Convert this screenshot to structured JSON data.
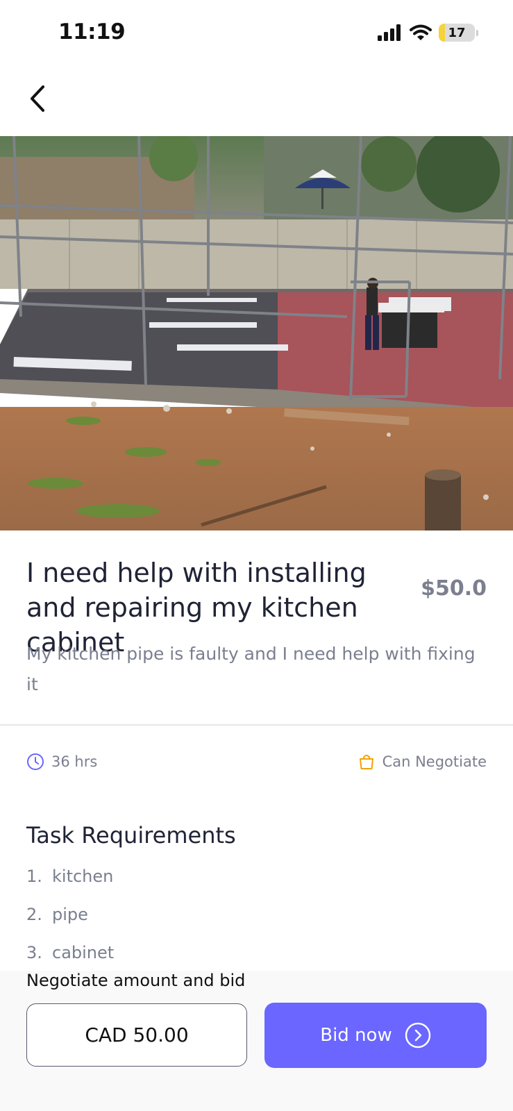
{
  "status_bar": {
    "time": "11:19",
    "battery": "17",
    "battery_level": 0.17,
    "icons": [
      "signal-icon",
      "wifi-icon",
      "battery-icon"
    ]
  },
  "nav": {
    "back_icon": "chevron-left-icon"
  },
  "task": {
    "title": "I need help with installing and repairing my kitchen cabinet",
    "price": "$50.0",
    "description": "My kitchen pipe is faulty and I need help with fixing it",
    "duration": "36 hrs",
    "negotiable": "Can Negotiate"
  },
  "requirements": {
    "heading": "Task Requirements",
    "items": [
      {
        "num": "1.",
        "label": "kitchen"
      },
      {
        "num": "2.",
        "label": "pipe"
      },
      {
        "num": "3.",
        "label": "cabinet"
      }
    ]
  },
  "bid": {
    "label": "Negotiate amount and bid",
    "amount": "CAD 50.00",
    "button": "Bid now"
  },
  "colors": {
    "accent": "#6a66ff",
    "clock_icon": "#6a66ff",
    "bag_icon": "#f0a400",
    "battery": "#f5d33a"
  }
}
